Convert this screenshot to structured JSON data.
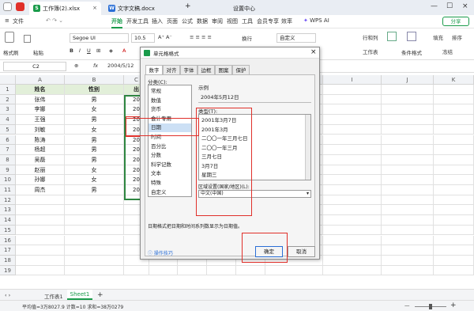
{
  "tabs": [
    {
      "label": "工作簿(2).xlsx",
      "icon": "S"
    },
    {
      "label": "文字文稿.docx",
      "icon": "W"
    }
  ],
  "new_tab": "+",
  "settings_center": "设置中心",
  "menu": {
    "file": "文件",
    "items": [
      "开始",
      "开发工具",
      "插入",
      "页面",
      "公式",
      "数据",
      "审阅",
      "视图",
      "工具",
      "会员专享",
      "效率"
    ],
    "wps_ai": "WPS AI",
    "share": "分享"
  },
  "toolbar": {
    "format_painter": "格式刷",
    "paste": "粘贴",
    "font": "Segoe UI",
    "size": "10.5",
    "wrap": "换行",
    "number_format": "自定义",
    "row_col": "行和列",
    "worksheet": "工作表",
    "conditional": "条件格式",
    "fill": "填充",
    "sort": "排序",
    "freeze": "冻结"
  },
  "formula_bar": {
    "cell_ref": "C2",
    "fx": "fx",
    "value": "2004/5/12"
  },
  "columns": [
    "A",
    "B",
    "C",
    "D",
    "E",
    "F",
    "G",
    "H",
    "I",
    "J",
    "K"
  ],
  "rows": [
    "1",
    "2",
    "3",
    "4",
    "5",
    "6",
    "7",
    "8",
    "9",
    "10",
    "11",
    "12",
    "13",
    "14",
    "15",
    "16",
    "17",
    "18",
    "19"
  ],
  "table": {
    "headers": [
      "姓名",
      "性别",
      "出"
    ],
    "rows": [
      [
        "张伟",
        "男",
        "20"
      ],
      [
        "李娜",
        "女",
        "20"
      ],
      [
        "王强",
        "男",
        "20"
      ],
      [
        "刘敏",
        "女",
        "20"
      ],
      [
        "陈涛",
        "男",
        "20"
      ],
      [
        "杨超",
        "男",
        "20"
      ],
      [
        "吴磊",
        "男",
        "20"
      ],
      [
        "赵丽",
        "女",
        "20"
      ],
      [
        "孙娜",
        "女",
        "20"
      ],
      [
        "周杰",
        "男",
        "20"
      ]
    ]
  },
  "dialog": {
    "title": "单元格格式",
    "tabs": [
      "数字",
      "对齐",
      "字体",
      "边框",
      "图案",
      "保护"
    ],
    "category_label": "分类(C):",
    "categories": [
      "常规",
      "数值",
      "货币",
      "会计专用",
      "日期",
      "时间",
      "百分比",
      "分数",
      "科学记数",
      "文本",
      "特殊",
      "自定义"
    ],
    "selected_category": "日期",
    "sample_label": "示例",
    "sample_value": "2004年5月12日",
    "type_label": "类型(T):",
    "types": [
      "2001年3月7日",
      "2001年3月",
      "二〇〇一年三月七日",
      "二〇〇一年三月",
      "三月七日",
      "3月7日",
      "星期三"
    ],
    "locale_label": "区域设置(国家/地区)(L):",
    "locale_value": "中文(中国)",
    "description": "日期格式把日期和时间系列数显示为日期值。",
    "tips": "操作技巧",
    "ok": "确定",
    "cancel": "取消"
  },
  "sheets": {
    "other": "工作表1",
    "active": "Sheet1",
    "add": "+"
  },
  "status": {
    "text": "平均值=3万8027.9   计数=10   求和=38万0279",
    "zoom_minus": "—",
    "zoom_plus": "+"
  },
  "colors": {
    "accent": "#1a9b4b",
    "highlight": "#e0302a",
    "selection": "#2e8540"
  }
}
